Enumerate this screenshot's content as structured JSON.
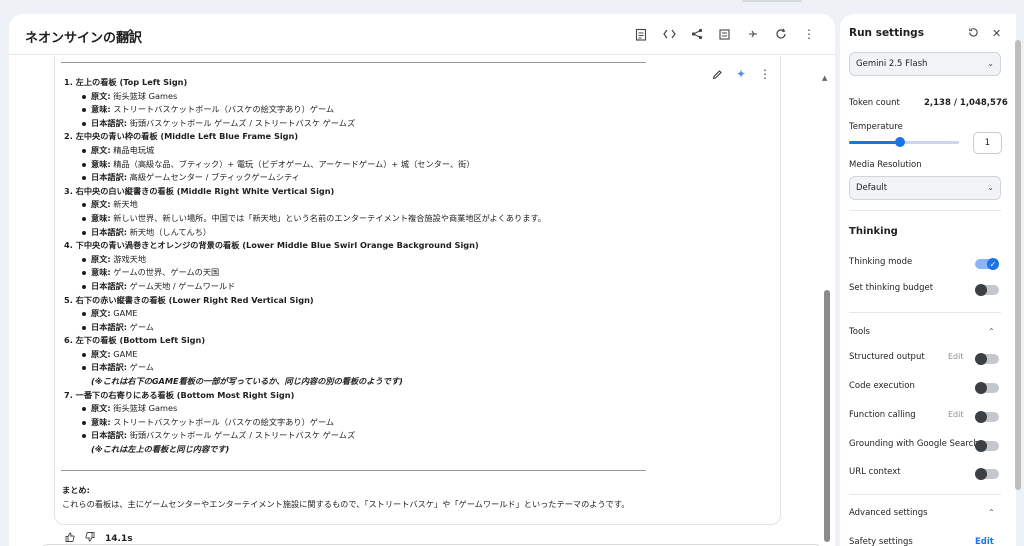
{
  "main": {
    "title": "ネオンサインの翻訳",
    "sections": [
      {
        "title": "1. 左上の看板 (Top Left Sign)",
        "items": [
          {
            "label": "原文:",
            "text": " 街头篮球 Games"
          },
          {
            "label": "意味:",
            "text": " ストリートバスケットボール（バスケの絵文字あり）ゲーム"
          },
          {
            "label": "日本語訳:",
            "text": " 街頭バスケットボール ゲームズ / ストリートバスケ ゲームズ"
          }
        ]
      },
      {
        "title": "2. 左中央の青い枠の看板 (Middle Left Blue Frame Sign)",
        "items": [
          {
            "label": "原文:",
            "text": " 精品电玩城"
          },
          {
            "label": "意味:",
            "text": " 精品（高級な品、ブティック）+ 電玩（ビデオゲーム、アーケードゲーム）+ 城（センター、街）"
          },
          {
            "label": "日本語訳:",
            "text": " 高級ゲームセンター / ブティックゲームシティ"
          }
        ]
      },
      {
        "title": "3. 右中央の白い縦書きの看板 (Middle Right White Vertical Sign)",
        "items": [
          {
            "label": "原文:",
            "text": " 新天地"
          },
          {
            "label": "意味:",
            "text": " 新しい世界、新しい場所。中国では「新天地」という名前のエンターテイメント複合施設や商業地区がよくあります。"
          },
          {
            "label": "日本語訳:",
            "text": " 新天地（しんてんち）"
          }
        ]
      },
      {
        "title": "4. 下中央の青い渦巻きとオレンジの背景の看板 (Lower Middle Blue Swirl Orange Background Sign)",
        "items": [
          {
            "label": "原文:",
            "text": " 游戏天地"
          },
          {
            "label": "意味:",
            "text": " ゲームの世界、ゲームの天国"
          },
          {
            "label": "日本語訳:",
            "text": " ゲーム天地 / ゲームワールド"
          }
        ]
      },
      {
        "title": "5. 右下の赤い縦書きの看板 (Lower Right Red Vertical Sign)",
        "items": [
          {
            "label": "原文:",
            "text": " GAME"
          },
          {
            "label": "日本語訳:",
            "text": " ゲーム"
          }
        ]
      },
      {
        "title": "6. 左下の看板 (Bottom Left Sign)",
        "items": [
          {
            "label": "原文:",
            "text": " GAME"
          },
          {
            "label": "日本語訳:",
            "text": " ゲーム"
          }
        ],
        "note": "(※これは右下のGAME看板の一部が写っているか、同じ内容の別の看板のようです)"
      },
      {
        "title": "7. 一番下の右寄りにある看板 (Bottom Most Right Sign)",
        "items": [
          {
            "label": "原文:",
            "text": " 街头篮球 Games"
          },
          {
            "label": "意味:",
            "text": " ストリートバスケットボール（バスケの絵文字あり）ゲーム"
          },
          {
            "label": "日本語訳:",
            "text": " 街頭バスケットボール ゲームズ / ストリートバスケ ゲームズ"
          }
        ],
        "note": "(※これは左上の看板と同じ内容です)"
      }
    ],
    "summary_label": "まとめ:",
    "summary_text": "これらの看板は、主にゲームセンターやエンターテイメント施設に関するもので、「ストリートバスケ」や「ゲームワールド」といったテーマのようです。",
    "time": "14.1s"
  },
  "side": {
    "title": "Run settings",
    "model": "Gemini 2.5 Flash",
    "token_label": "Token count",
    "token_value": "2,138 / 1,048,576",
    "temperature_label": "Temperature",
    "temperature_value": "1",
    "temperature_fraction": 0.5,
    "media_label": "Media Resolution",
    "media_value": "Default",
    "thinking_header": "Thinking",
    "thinking_mode": "Thinking mode",
    "thinking_budget": "Set thinking budget",
    "tools_header": "Tools",
    "structured_output": "Structured output",
    "code_execution": "Code execution",
    "function_calling": "Function calling",
    "grounding": "Grounding with Google Search",
    "url_context": "URL context",
    "edit": "Edit",
    "advanced_header": "Advanced settings",
    "safety": "Safety settings",
    "safety_edit": "Edit"
  },
  "colors": {
    "accent": "#1a73e8"
  }
}
